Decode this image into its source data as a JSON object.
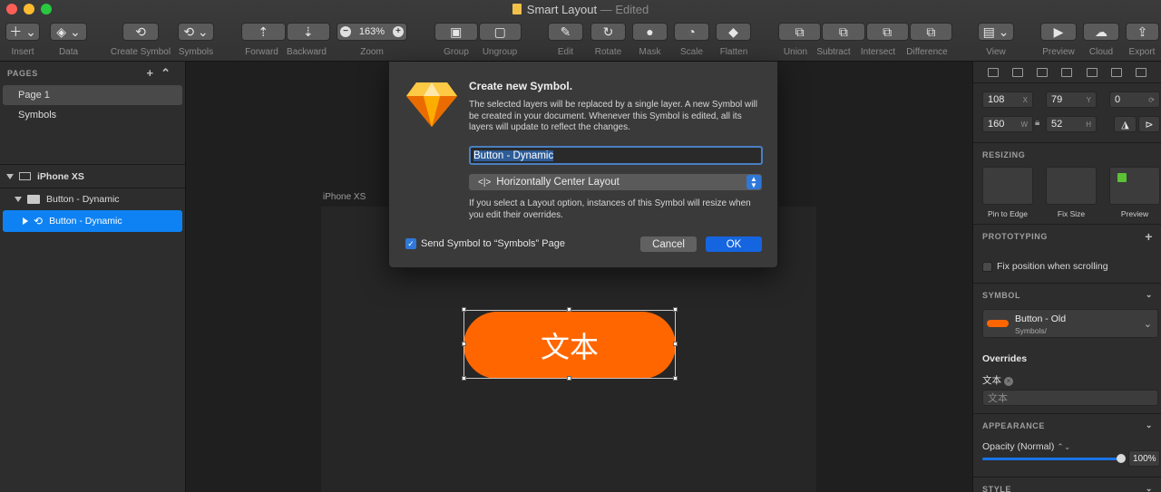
{
  "window": {
    "title": "Smart Layout",
    "status": "— Edited"
  },
  "toolbar": {
    "insert": "Insert",
    "data": "Data",
    "create_symbol": "Create Symbol",
    "symbols": "Symbols",
    "forward": "Forward",
    "backward": "Backward",
    "zoom": "Zoom",
    "zoom_value": "163%",
    "group": "Group",
    "ungroup": "Ungroup",
    "edit": "Edit",
    "rotate": "Rotate",
    "mask": "Mask",
    "scale": "Scale",
    "flatten": "Flatten",
    "union": "Union",
    "subtract": "Subtract",
    "intersect": "Intersect",
    "difference": "Difference",
    "view": "View",
    "preview": "Preview",
    "cloud": "Cloud",
    "export": "Export"
  },
  "sidebar": {
    "pages_header": "PAGES",
    "pages": [
      "Page 1",
      "Symbols"
    ],
    "artboard": "iPhone XS",
    "layers": [
      {
        "label": "Button - Dynamic"
      },
      {
        "label": "Button - Dynamic"
      }
    ]
  },
  "canvas": {
    "artboard_label": "iPhone XS",
    "button_text": "文本"
  },
  "dialog": {
    "title": "Create new Symbol.",
    "description": "The selected layers will be replaced by a single layer. A new Symbol will be created in your document. Whenever this Symbol is edited, all its layers will update to reflect the changes.",
    "name_value": "Button - Dynamic",
    "layout_option": "Horizontally Center Layout",
    "layout_note": "If you select a Layout option, instances of this Symbol will resize when you edit their overrides.",
    "checkbox_label": "Send Symbol to “Symbols” Page",
    "cancel": "Cancel",
    "ok": "OK"
  },
  "inspector": {
    "x": "108",
    "x_unit": "X",
    "y": "79",
    "y_unit": "Y",
    "rotation": "0",
    "w": "160",
    "w_unit": "W",
    "h": "52",
    "h_unit": "H",
    "resizing": "RESIZING",
    "pin_to_edge": "Pin to Edge",
    "fix_size": "Fix Size",
    "preview": "Preview",
    "prototyping": "PROTOTYPING",
    "fix_position": "Fix position when scrolling",
    "symbol": "SYMBOL",
    "symbol_name": "Button - Old",
    "symbol_path": "Symbols/",
    "overrides": "Overrides",
    "override_label": "文本",
    "override_placeholder": "文本",
    "appearance": "APPEARANCE",
    "opacity_label": "Opacity (Normal)",
    "opacity_value": "100%",
    "style": "STYLE"
  },
  "colors": {
    "accent": "#0e82f3",
    "button": "#ff6600",
    "ok": "#1565e0"
  }
}
